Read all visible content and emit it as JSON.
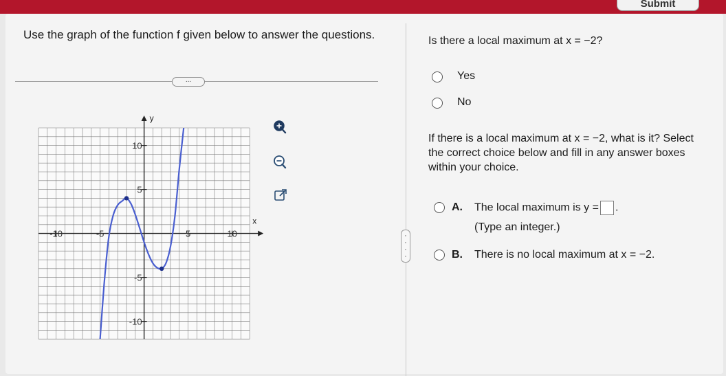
{
  "header": {
    "submit_label": "Submit",
    "accent_color": "#b3162b"
  },
  "left": {
    "instructions": "Use the graph of the function f given below to answer the questions.",
    "more_label": "...",
    "tools": {
      "zoom_in": "zoom-in-icon",
      "zoom_out": "zoom-out-icon",
      "popout": "external-link-icon"
    }
  },
  "chart_data": {
    "type": "line",
    "x_axis_label": "x",
    "y_axis_label": "y",
    "xlim": [
      -12,
      12
    ],
    "ylim": [
      -12,
      12
    ],
    "x_tick_labels": [
      {
        "value": -10,
        "text": "-10"
      },
      {
        "value": -5,
        "text": "-5"
      },
      {
        "value": 5,
        "text": "5"
      },
      {
        "value": 10,
        "text": "10"
      }
    ],
    "y_tick_labels": [
      {
        "value": 10,
        "text": "10"
      },
      {
        "value": 5,
        "text": "5"
      },
      {
        "value": -5,
        "text": "-5"
      },
      {
        "value": -10,
        "text": "-10"
      }
    ],
    "grid": true,
    "curve_color": "#4a5fd0",
    "point_color": "#1d2f8a",
    "curve": [
      [
        -5,
        -12
      ],
      [
        -4.5,
        -5.28
      ],
      [
        -4,
        -0.33
      ],
      [
        -3.5,
        2.11
      ],
      [
        -3,
        3.23
      ],
      [
        -2.5,
        3.68
      ],
      [
        -2,
        4
      ],
      [
        -1.5,
        3.39
      ],
      [
        -1,
        2.14
      ],
      [
        -0.5,
        0.59
      ],
      [
        0,
        -1
      ],
      [
        0.5,
        -2.37
      ],
      [
        1,
        -3.39
      ],
      [
        1.5,
        -3.91
      ],
      [
        2,
        -4
      ],
      [
        2.5,
        -3.34
      ],
      [
        3,
        -1.48
      ],
      [
        3.5,
        1.95
      ],
      [
        4,
        7.33
      ],
      [
        4.5,
        12
      ]
    ],
    "marked_points": [
      [
        -2,
        4
      ],
      [
        2,
        -4
      ]
    ]
  },
  "right": {
    "question1": "Is there a local maximum at x = −2?",
    "options1": [
      "Yes",
      "No"
    ],
    "question2": "If there is a local maximum at x = −2, what is it? Select the correct choice below and fill in any answer boxes within your choice.",
    "optionA_letter": "A.",
    "optionA_prefix": "The local maximum is y =",
    "optionA_suffix": ".",
    "optionA_hint": "(Type an integer.)",
    "optionB_letter": "B.",
    "optionB_text": "There is no local maximum at x = −2."
  }
}
